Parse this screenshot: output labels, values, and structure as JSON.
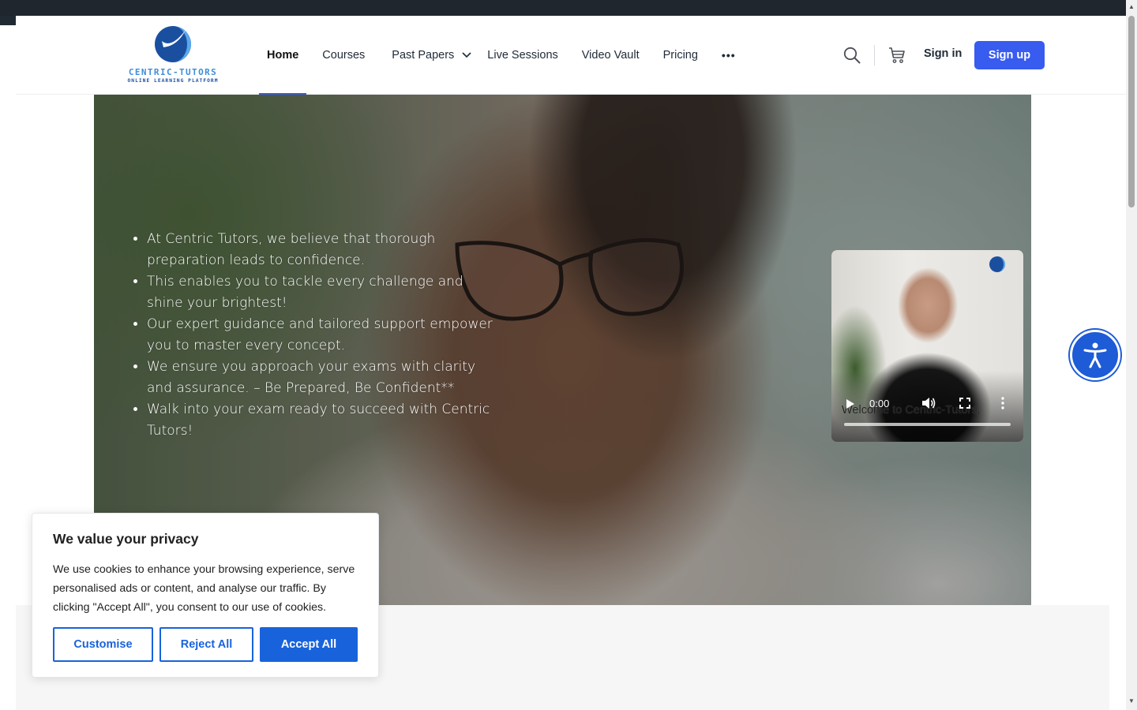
{
  "brand": {
    "name": "CENTRIC-TUTORS",
    "tagline": "ONLINE LEARNING PLATFORM",
    "accent": "#385bf0"
  },
  "nav": {
    "items": [
      {
        "label": "Home"
      },
      {
        "label": "Courses"
      },
      {
        "label": "Past Papers"
      },
      {
        "label": "Live Sessions"
      },
      {
        "label": "Video Vault"
      },
      {
        "label": "Pricing"
      }
    ],
    "more": "•••",
    "signin": "Sign in",
    "signup": "Sign up"
  },
  "hero": {
    "bullets": [
      "At Centric Tutors, we believe that thorough preparation leads to confidence.",
      "This enables you to tackle every challenge and shine your brightest!",
      "Our expert guidance and tailored support empower you to master every concept.",
      "We ensure you approach your exams with clarity and assurance. – Be Prepared, Be Confident**",
      "Walk into your exam ready to succeed with Centric Tutors!"
    ]
  },
  "video": {
    "caption": "Welcome to Centric-Tutors,",
    "time": "0:00"
  },
  "cookie": {
    "title": "We value your privacy",
    "text": "We use cookies to enhance your browsing experience, serve personalised ads or content, and analyse our traffic. By clicking \"Accept All\", you consent to our use of cookies.",
    "customise": "Customise",
    "reject": "Reject All",
    "accept": "Accept All",
    "color": "#1863dc"
  },
  "icons": {
    "search": "search-icon",
    "cart": "cart-icon",
    "accessibility": "accessibility-icon"
  }
}
